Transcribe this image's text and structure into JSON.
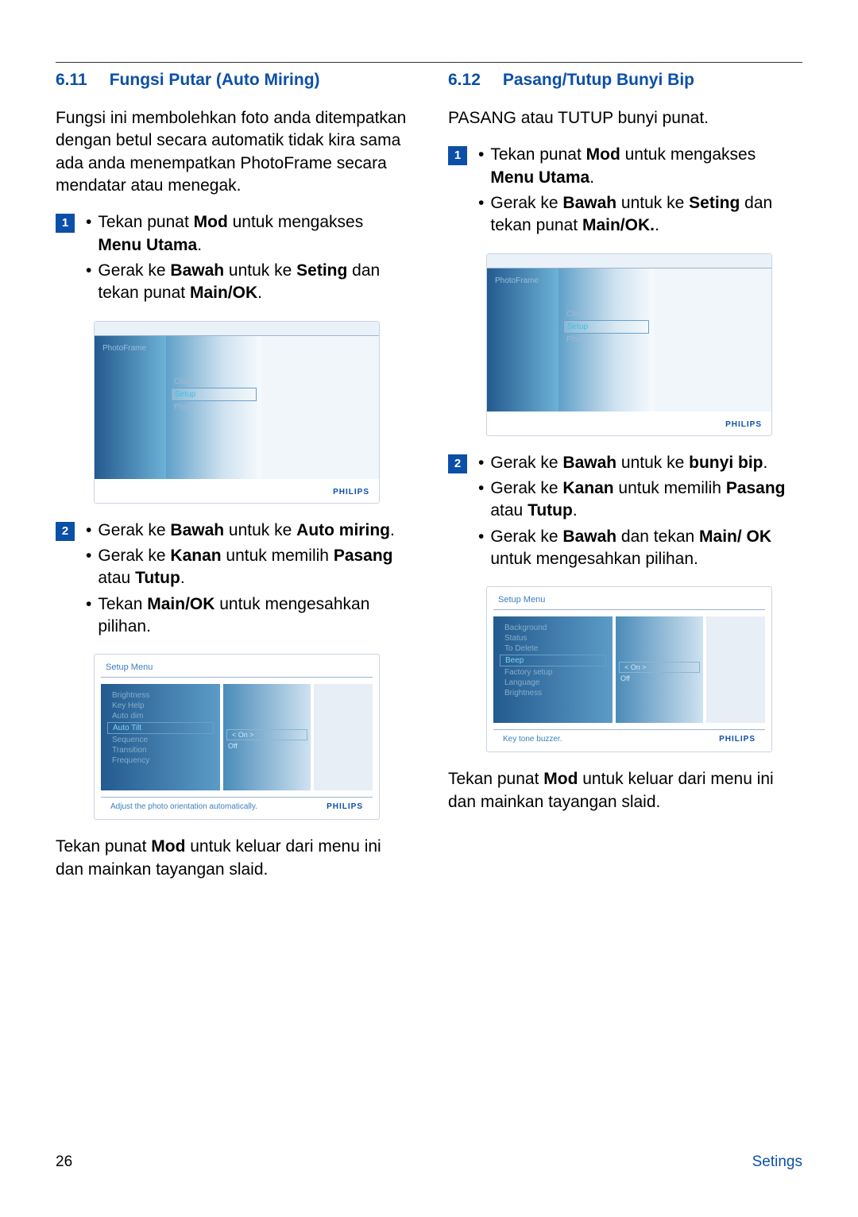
{
  "left": {
    "heading_num": "6.11",
    "heading_title": "Fungsi Putar (Auto Miring)",
    "intro": "Fungsi ini membolehkan foto anda ditempatkan dengan betul secara automatik tidak kira sama ada anda menempatkan PhotoFrame secara mendatar atau menegak.",
    "step1_b1_pre": "Tekan punat ",
    "step1_b1_bold1": "Mod",
    "step1_b1_mid": " untuk mengakses ",
    "step1_b1_bold2": "Menu Utama",
    "step1_b1_post": ".",
    "step1_b2_pre": "Gerak ke ",
    "step1_b2_bold1": "Bawah",
    "step1_b2_mid": " untuk ke ",
    "step1_b2_bold2": "Seting",
    "step1_b2_mid2": " dan tekan punat ",
    "step1_b2_bold3": "Main/OK",
    "step1_b2_post": ".",
    "devA_label": "PhotoFrame",
    "devA_m1": "Clock",
    "devA_m2": "Setup",
    "devA_m3": "Photo",
    "step2_b1_pre": "Gerak ke ",
    "step2_b1_bold1": "Bawah",
    "step2_b1_mid": " untuk ke ",
    "step2_b1_bold2": "Auto miring",
    "step2_b1_post": ".",
    "step2_b2_pre": "Gerak ke ",
    "step2_b2_bold1": "Kanan",
    "step2_b2_mid": " untuk memilih ",
    "step2_b2_bold2": "Pasang",
    "step2_b2_mid2": " atau ",
    "step2_b2_bold3": "Tutup",
    "step2_b2_post": ".",
    "step2_b3_pre": "Tekan ",
    "step2_b3_bold1": "Main/OK",
    "step2_b3_post": " untuk mengesahkan pilihan.",
    "devB_title": "Setup Menu",
    "devB_i1": "Brightness",
    "devB_i2": "Key Help",
    "devB_i3": "Auto dim",
    "devB_i4": "Auto Tilt",
    "devB_i5": "Sequence",
    "devB_i6": "Transition",
    "devB_i7": "Frequency",
    "devB_o1": "< On >",
    "devB_o2": "Off",
    "devB_foot": "Adjust the photo orientation automatically.",
    "closing_pre": "Tekan punat ",
    "closing_bold": "Mod",
    "closing_post": " untuk keluar dari menu ini dan mainkan tayangan slaid."
  },
  "right": {
    "heading_num": "6.12",
    "heading_title": "Pasang/Tutup Bunyi Bip",
    "intro": "PASANG atau TUTUP bunyi punat.",
    "step1_b1_pre": "Tekan punat ",
    "step1_b1_bold1": "Mod",
    "step1_b1_mid": " untuk mengakses ",
    "step1_b1_bold2": "Menu Utama",
    "step1_b1_post": ".",
    "step1_b2_pre": "Gerak ke ",
    "step1_b2_bold1": "Bawah",
    "step1_b2_mid": " untuk ke ",
    "step1_b2_bold2": "Seting",
    "step1_b2_mid2": " dan tekan punat ",
    "step1_b2_bold3": "Main/OK.",
    "step1_b2_post": ".",
    "devA_label": "PhotoFrame",
    "devA_m1": "Clock",
    "devA_m2": "Setup",
    "devA_m3": "Photo",
    "step2_b1_pre": "Gerak ke ",
    "step2_b1_bold1": "Bawah",
    "step2_b1_mid": " untuk ke ",
    "step2_b1_bold2": "bunyi bip",
    "step2_b1_post": ".",
    "step2_b2_pre": "Gerak ke ",
    "step2_b2_bold1": "Kanan",
    "step2_b2_mid": " untuk memilih ",
    "step2_b2_bold2": "Pasang",
    "step2_b2_mid2": " atau ",
    "step2_b2_bold3": "Tutup",
    "step2_b2_post": ".",
    "step2_b3_pre": "Gerak ke ",
    "step2_b3_bold1": "Bawah",
    "step2_b3_mid": " dan tekan ",
    "step2_b3_bold2": "Main/ OK",
    "step2_b3_post": " untuk mengesahkan pilihan.",
    "devB_title": "Setup Menu",
    "devB_i1": "Background",
    "devB_i2": "Status",
    "devB_i3": "To Delete",
    "devB_i4": "Beep",
    "devB_i5": "Factory setup",
    "devB_i6": "Language",
    "devB_i7": "Brightness",
    "devB_o1": "< On >",
    "devB_o2": "Off",
    "devB_foot": "Key tone buzzer.",
    "closing_pre": "Tekan punat ",
    "closing_bold": "Mod",
    "closing_post": " untuk keluar dari menu ini dan mainkan tayangan slaid."
  },
  "footer": {
    "page": "26",
    "section": "Setings"
  },
  "brand": "PHILIPS"
}
